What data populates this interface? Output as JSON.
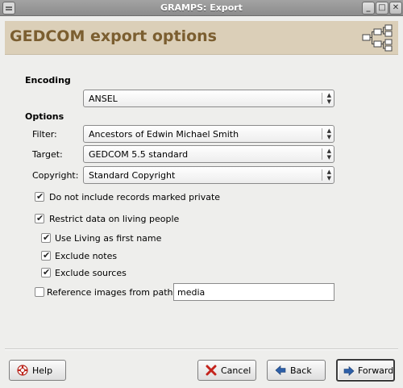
{
  "window": {
    "title": "GRAMPS: Export"
  },
  "header": {
    "title": "GEDCOM export options",
    "logo_icon": "gramps-tree-logo-icon"
  },
  "encoding": {
    "section_label": "Encoding",
    "value": "ANSEL"
  },
  "options": {
    "section_label": "Options",
    "filter": {
      "label": "Filter:",
      "value": "Ancestors of Edwin Michael Smith"
    },
    "target": {
      "label": "Target:",
      "value": "GEDCOM 5.5 standard"
    },
    "copyright": {
      "label": "Copyright:",
      "value": "Standard Copyright"
    }
  },
  "checks": {
    "private": {
      "label": "Do not include records marked private",
      "checked": true
    },
    "living": {
      "label": "Restrict data on living people",
      "checked": true
    },
    "living_first": {
      "label": "Use Living as first name",
      "checked": true
    },
    "notes": {
      "label": "Exclude notes",
      "checked": true
    },
    "sources": {
      "label": "Exclude sources",
      "checked": true
    },
    "images": {
      "label": "Reference images from path:",
      "checked": false
    }
  },
  "images_path": {
    "value": "media"
  },
  "buttons": {
    "help": "Help",
    "cancel": "Cancel",
    "back": "Back",
    "forward": "Forward"
  },
  "colors": {
    "header_bg": "#dbcfb8",
    "header_text": "#7b5e30",
    "cancel_red": "#c4231c",
    "nav_blue": "#2d5fa8"
  }
}
